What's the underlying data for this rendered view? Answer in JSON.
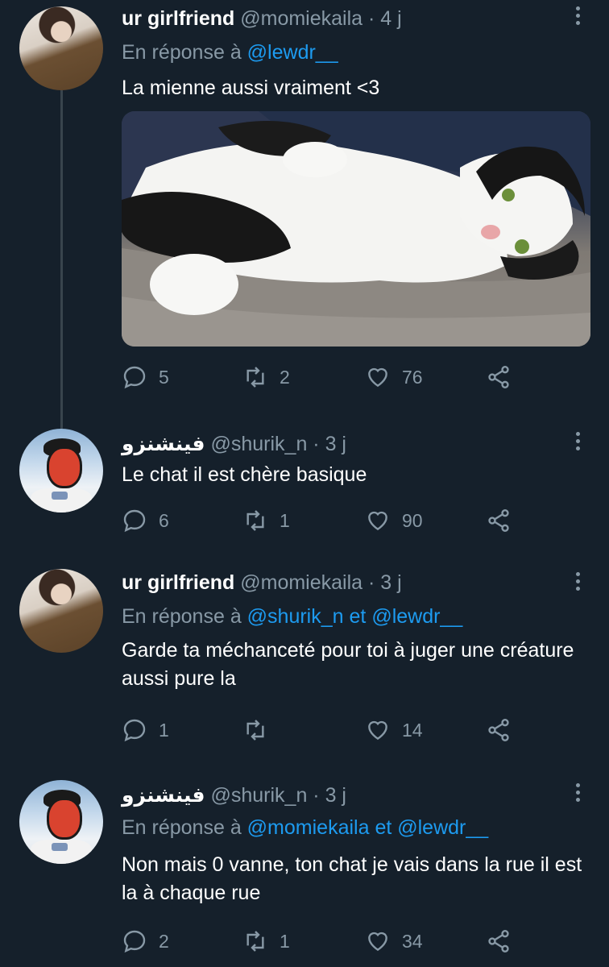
{
  "tweets": [
    {
      "name": "ur girlfriend",
      "handle": "@momiekaila",
      "sep": "·",
      "time": "4 j",
      "replying_prefix": "En réponse à",
      "replying_to": "@lewdr__",
      "replying_and": "",
      "replying_to2": "",
      "text": "La mienne aussi vraiment <3",
      "replies": "5",
      "retweets": "2",
      "likes": "76"
    },
    {
      "name": "فينشنزو",
      "handle": "@shurik_n",
      "sep": "·",
      "time": "3 j",
      "text": "Le chat il est chère basique",
      "replies": "6",
      "retweets": "1",
      "likes": "90"
    },
    {
      "name": "ur girlfriend",
      "handle": "@momiekaila",
      "sep": "·",
      "time": "3 j",
      "replying_prefix": "En réponse à",
      "replying_to": "@shurik_n",
      "replying_and": "et",
      "replying_to2": "@lewdr__",
      "text": "Garde ta méchanceté pour toi à juger une créature aussi pure la",
      "replies": "1",
      "retweets": "",
      "likes": "14"
    },
    {
      "name": "فينشنزو",
      "handle": "@shurik_n",
      "sep": "·",
      "time": "3 j",
      "replying_prefix": "En réponse à",
      "replying_to": "@momiekaila",
      "replying_and": "et",
      "replying_to2": "@lewdr__",
      "text": "Non mais 0 vanne, ton chat je vais dans la rue il est la à chaque rue",
      "replies": "2",
      "retweets": "1",
      "likes": "34"
    }
  ],
  "icons": {
    "reply": "reply-icon",
    "retweet": "retweet-icon",
    "like": "heart-icon",
    "share": "share-icon",
    "more": "more-vertical-icon"
  },
  "colors": {
    "background": "#15202b",
    "secondary_text": "#8899a6",
    "link": "#1d9bf0",
    "thread_line": "#38444d"
  }
}
